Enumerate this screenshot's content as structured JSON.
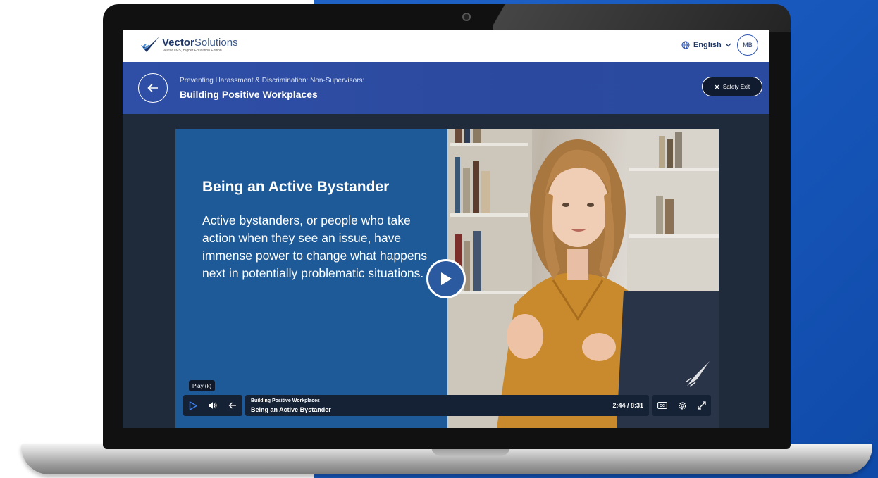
{
  "header": {
    "logo_name_bold": "Vector",
    "logo_name_light": "Solutions",
    "logo_tagline": "Vector LMS, Higher Education Edition",
    "language": "English",
    "user_initials": "MB"
  },
  "course": {
    "breadcrumb": "Preventing Harassment & Discrimination: Non-Supervisors:",
    "title": "Building Positive Workplaces",
    "safety_exit_label": "Safety Exit"
  },
  "slide": {
    "heading": "Being an Active Bystander",
    "body": "Active bystanders, or people who take action when they see an issue, have immense power to change what happens next in potentially problematic situations."
  },
  "player": {
    "tooltip": "Play (k)",
    "module_title": "Building Positive Workplaces",
    "lesson_title": "Being an Active Bystander",
    "time": "2:44 / 8:31",
    "cc_label": "CC"
  },
  "colors": {
    "brand_blue": "#2f4ea6",
    "slide_blue": "#1e5a98",
    "control_bg": "#152236",
    "play_accent": "#3d82f0"
  },
  "icons": {
    "globe": "globe-icon",
    "chevron": "chevron-down-icon",
    "back": "arrow-left-icon",
    "close": "close-icon",
    "play": "play-icon",
    "volume": "volume-icon",
    "rewind": "arrow-left-icon",
    "captions": "closed-captions-icon",
    "settings": "gear-icon",
    "fullscreen": "fullscreen-icon"
  }
}
